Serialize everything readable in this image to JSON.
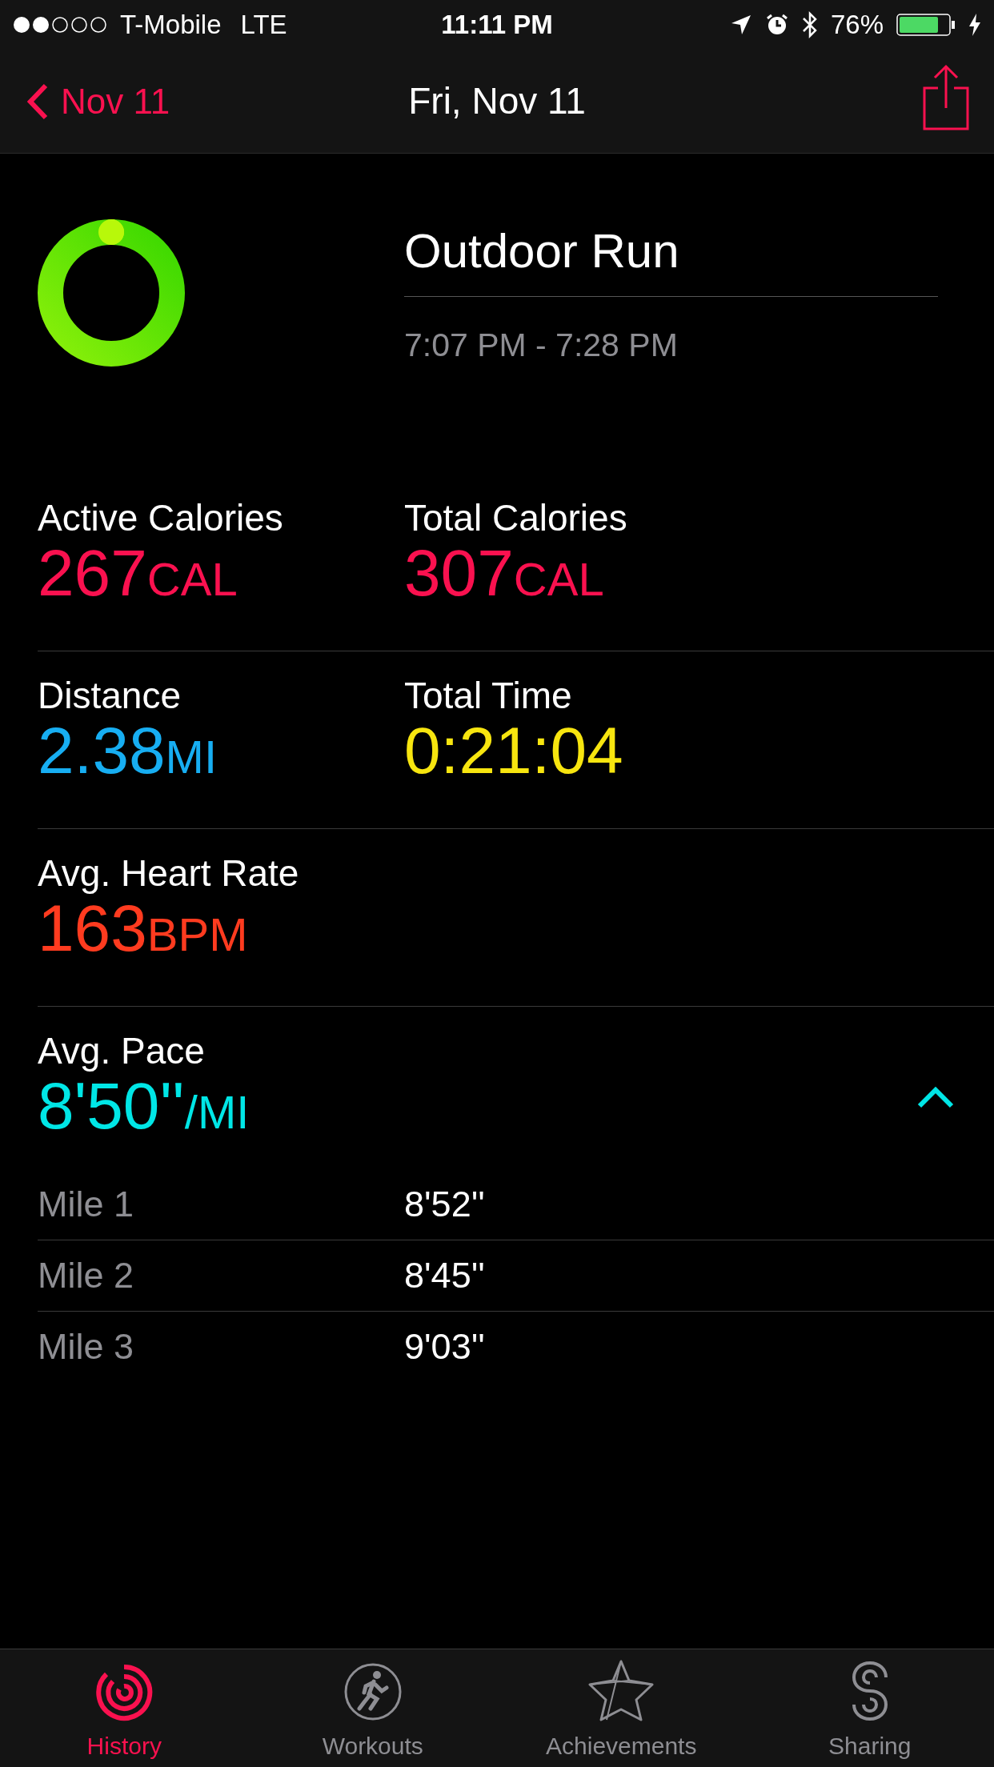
{
  "status_bar": {
    "carrier": "T-Mobile",
    "network": "LTE",
    "time": "11:11 PM",
    "battery": "76%"
  },
  "nav": {
    "back": "Nov 11",
    "title": "Fri, Nov 11"
  },
  "workout": {
    "name": "Outdoor Run",
    "time_range": "7:07 PM - 7:28 PM"
  },
  "metric_rows": [
    [
      {
        "label": "Active Calories",
        "value": "267",
        "unit": "CAL",
        "color": "#fa114f"
      },
      {
        "label": "Total Calories",
        "value": "307",
        "unit": "CAL",
        "color": "#fa114f"
      }
    ],
    [
      {
        "label": "Distance",
        "value": "2.38",
        "unit": "MI",
        "color": "#17aef2"
      },
      {
        "label": "Total Time",
        "value": "0:21:04",
        "color": "#f7e50f"
      }
    ],
    [
      {
        "label": "Avg. Heart Rate",
        "value": "163",
        "unit": "BPM",
        "color": "#ff3b1f"
      }
    ]
  ],
  "pace": {
    "label": "Avg. Pace",
    "value": "8'50''",
    "unit": "/MI",
    "color": "#00e6e6",
    "expanded": true,
    "splits": [
      {
        "label": "Mile 1",
        "value": "8'52''"
      },
      {
        "label": "Mile 2",
        "value": "8'45''"
      },
      {
        "label": "Mile 3",
        "value": "9'03''"
      }
    ]
  },
  "tabs": [
    {
      "label": "History",
      "selected": true
    },
    {
      "label": "Workouts",
      "selected": false
    },
    {
      "label": "Achievements",
      "selected": false
    },
    {
      "label": "Sharing",
      "selected": false
    }
  ]
}
